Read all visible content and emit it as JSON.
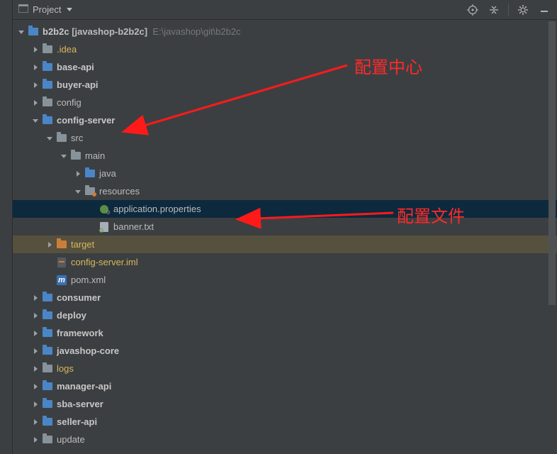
{
  "toolbar": {
    "project_label": "Project"
  },
  "root": {
    "name": "b2b2c",
    "bracket_text": "[javashop-b2b2c]",
    "path": "E:\\javashop\\git\\b2b2c"
  },
  "tree": {
    "idea": ".idea",
    "base_api": "base-api",
    "buyer_api": "buyer-api",
    "config": "config",
    "config_server": "config-server",
    "src": "src",
    "main": "main",
    "java": "java",
    "resources": "resources",
    "app_props": "application.properties",
    "banner": "banner.txt",
    "target": "target",
    "iml": "config-server.iml",
    "pom": "pom.xml",
    "consumer": "consumer",
    "deploy": "deploy",
    "framework": "framework",
    "javashop_core": "javashop-core",
    "logs": "logs",
    "manager_api": "manager-api",
    "sba_server": "sba-server",
    "seller_api": "seller-api",
    "update": "update"
  },
  "annotations": {
    "config_center": "配置中心",
    "config_file": "配置文件"
  }
}
